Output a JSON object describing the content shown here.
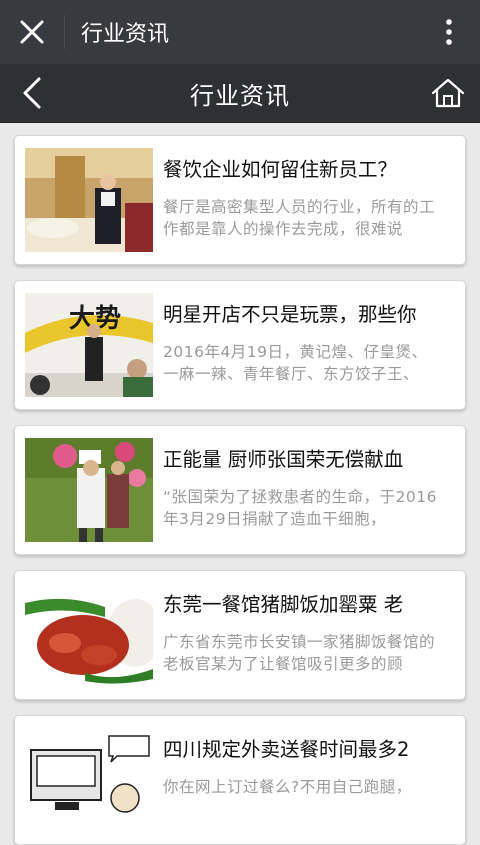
{
  "window": {
    "title": "行业资讯"
  },
  "nav": {
    "title": "行业资讯"
  },
  "colors": {
    "topbar": "#393a3f",
    "navbar": "#2f3034",
    "background": "#e9e9e9"
  },
  "articles": [
    {
      "title": "餐饮企业如何留住新员工？",
      "summary": "餐厅是高密集型人员的行业，所有的工作都是靠人的操作去完成，很难说"
    },
    {
      "title": "明星开店不只是玩票，那些你",
      "summary": "2016年4月19日，黄记煌、仔皇煲、一麻一辣、青年餐厅、东方饺子王、"
    },
    {
      "title": "正能量 厨师张国荣无偿献血",
      "summary": "“张国荣为了拯救患者的生命，于2016年3月29日捐献了造血干细胞，"
    },
    {
      "title": "东莞一餐馆猪脚饭加罂粟 老",
      "summary": "广东省东莞市长安镇一家猪脚饭餐馆的老板官某为了让餐馆吸引更多的顾"
    },
    {
      "title": "四川规定外卖送餐时间最多2",
      "summary": "你在网上订过餐么?不用自己跑腿，"
    }
  ]
}
